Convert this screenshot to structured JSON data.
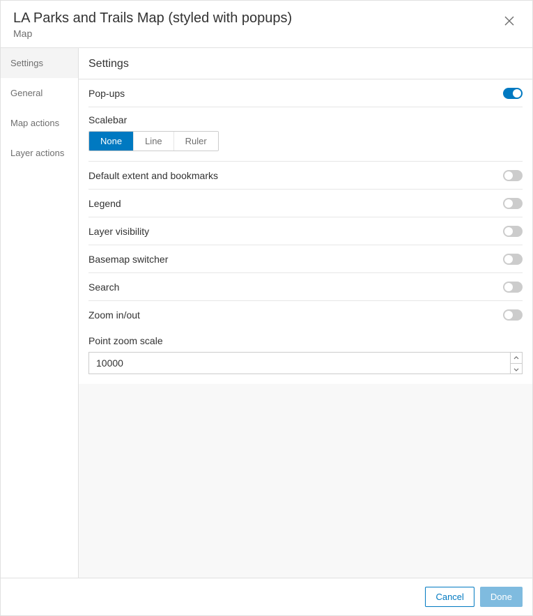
{
  "header": {
    "title": "LA Parks and Trails Map (styled with popups)",
    "subtitle": "Map"
  },
  "sidebar": {
    "items": [
      {
        "label": "Settings",
        "active": true
      },
      {
        "label": "General",
        "active": false
      },
      {
        "label": "Map actions",
        "active": false
      },
      {
        "label": "Layer actions",
        "active": false
      }
    ]
  },
  "panel": {
    "heading": "Settings",
    "popups": {
      "label": "Pop-ups",
      "value": true
    },
    "scalebar": {
      "label": "Scalebar",
      "options": [
        {
          "label": "None",
          "active": true
        },
        {
          "label": "Line",
          "active": false
        },
        {
          "label": "Ruler",
          "active": false
        }
      ]
    },
    "toggles": [
      {
        "key": "default-extent-bookmarks",
        "label": "Default extent and bookmarks",
        "value": false
      },
      {
        "key": "legend",
        "label": "Legend",
        "value": false
      },
      {
        "key": "layer-visibility",
        "label": "Layer visibility",
        "value": false
      },
      {
        "key": "basemap-switcher",
        "label": "Basemap switcher",
        "value": false
      },
      {
        "key": "search",
        "label": "Search",
        "value": false
      },
      {
        "key": "zoom-in-out",
        "label": "Zoom in/out",
        "value": false
      }
    ],
    "pointZoomScale": {
      "label": "Point zoom scale",
      "value": "10000"
    }
  },
  "footer": {
    "cancel": "Cancel",
    "done": "Done"
  }
}
